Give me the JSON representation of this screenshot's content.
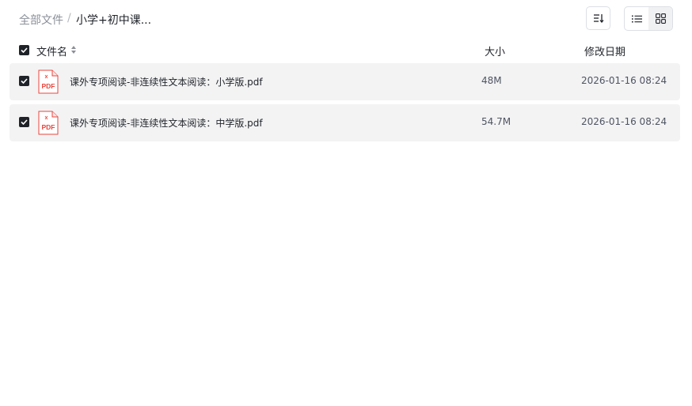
{
  "breadcrumb": {
    "root": "全部文件",
    "separator": "/",
    "current": "小学+初中课..."
  },
  "columns": {
    "name": "文件名",
    "size": "大小",
    "date": "修改日期"
  },
  "files": [
    {
      "name": "课外专项阅读-非连续性文本阅读：小学版.pdf",
      "size": "48M",
      "date": "2026-01-16 08:24",
      "icon_text": "PDF",
      "checked": true
    },
    {
      "name": "课外专项阅读-非连续性文本阅读：中学版.pdf",
      "size": "54.7M",
      "date": "2026-01-16 08:24",
      "icon_text": "PDF",
      "checked": true
    }
  ],
  "toolbar": {
    "sort_icon": "sort-icon",
    "list_view_icon": "list-view-icon",
    "grid_view_icon": "grid-view-icon",
    "active_view": "list"
  },
  "colors": {
    "row_bg": "#f3f3f4",
    "pdf_red": "#e8453c",
    "checkbox": "#1f2329"
  }
}
